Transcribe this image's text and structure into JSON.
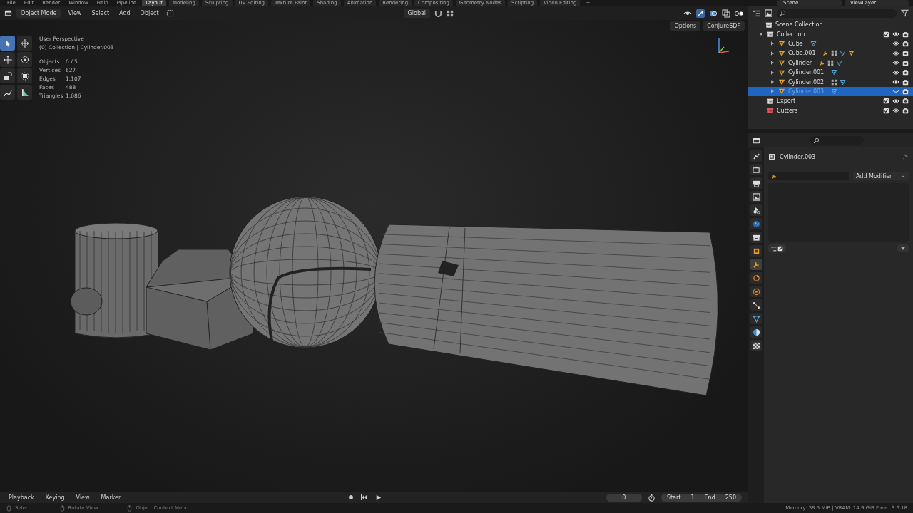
{
  "top_menu": [
    "File",
    "Edit",
    "Render",
    "Window",
    "Help",
    "Pipeline"
  ],
  "workspace_tabs": [
    {
      "label": "Layout",
      "selected": true
    },
    {
      "label": "Modeling",
      "selected": false
    },
    {
      "label": "Sculpting",
      "selected": false
    },
    {
      "label": "UV Editing",
      "selected": false
    },
    {
      "label": "Texture Paint",
      "selected": false
    },
    {
      "label": "Shading",
      "selected": false
    },
    {
      "label": "Animation",
      "selected": false
    },
    {
      "label": "Rendering",
      "selected": false
    },
    {
      "label": "Compositing",
      "selected": false
    },
    {
      "label": "Geometry Nodes",
      "selected": false
    },
    {
      "label": "Scripting",
      "selected": false
    },
    {
      "label": "Video Editing",
      "selected": false
    }
  ],
  "add_tab": "+",
  "scene": "Scene",
  "view_layer": "ViewLayer",
  "header": {
    "mode": "Object Mode",
    "menus": [
      "View",
      "Select",
      "Add",
      "Object"
    ],
    "orientation": "Global"
  },
  "viewport": {
    "buttons": [
      "Options",
      "ConjureSDF"
    ],
    "view_name": "User Perspective",
    "context": "(0) Collection | Cylinder.003",
    "stats": [
      {
        "label": "Objects",
        "value": "0 / 5"
      },
      {
        "label": "Vertices",
        "value": "627"
      },
      {
        "label": "Edges",
        "value": "1,107"
      },
      {
        "label": "Faces",
        "value": "488"
      },
      {
        "label": "Triangles",
        "value": "1,086"
      }
    ],
    "tools": [
      {
        "kind": "select",
        "selected": true
      },
      {
        "kind": "cursor",
        "selected": false
      },
      {
        "kind": "move",
        "selected": false
      },
      {
        "kind": "rotate",
        "selected": false
      },
      {
        "kind": "scale",
        "selected": false
      },
      {
        "kind": "transform",
        "selected": false
      },
      {
        "kind": "annotate",
        "selected": false
      },
      {
        "kind": "measure",
        "selected": false
      }
    ]
  },
  "outliner": {
    "root": "Scene Collection",
    "items": [
      {
        "name": "Collection",
        "kind": "collection",
        "checked": true,
        "expanded": true,
        "children": [
          {
            "name": "Cube",
            "kind": "object",
            "selected": false,
            "visible": true,
            "badges": [
              {
                "kind": "mesh"
              }
            ]
          },
          {
            "name": "Cube.001",
            "kind": "object",
            "selected": false,
            "visible": true,
            "badges": [
              {
                "kind": "wrench"
              },
              {
                "kind": "grid"
              },
              {
                "kind": "mesh"
              },
              {
                "kind": "object"
              }
            ]
          },
          {
            "name": "Cylinder",
            "kind": "object",
            "selected": false,
            "visible": true,
            "badges": [
              {
                "kind": "wrench"
              },
              {
                "kind": "grid"
              },
              {
                "kind": "mesh"
              }
            ]
          },
          {
            "name": "Cylinder.001",
            "kind": "object",
            "selected": false,
            "visible": true,
            "badges": [
              {
                "kind": "mesh"
              }
            ]
          },
          {
            "name": "Cylinder.002",
            "kind": "object",
            "selected": false,
            "visible": true,
            "badges": [
              {
                "kind": "grid"
              },
              {
                "kind": "mesh"
              }
            ]
          },
          {
            "name": "Cylinder.003",
            "kind": "object",
            "selected": true,
            "visible": false,
            "badges": [
              {
                "kind": "mesh"
              }
            ]
          }
        ]
      },
      {
        "name": "Export",
        "kind": "collection",
        "checked": true
      },
      {
        "name": "Cutters",
        "kind": "collection",
        "checked": true,
        "color": "#e05656"
      }
    ]
  },
  "properties": {
    "object_name": "Cylinder.003",
    "add_button": "Add Modifier",
    "tabs": [
      {
        "kind": "tool",
        "selected": false
      },
      {
        "kind": "render",
        "selected": false
      },
      {
        "kind": "output",
        "selected": false
      },
      {
        "kind": "view",
        "selected": false
      },
      {
        "kind": "scene",
        "selected": false
      },
      {
        "kind": "world",
        "selected": false
      },
      {
        "kind": "collection",
        "selected": false
      },
      {
        "kind": "object",
        "selected": false
      },
      {
        "kind": "wrench",
        "selected": true
      },
      {
        "kind": "particles",
        "selected": false
      },
      {
        "kind": "physics",
        "selected": false
      },
      {
        "kind": "constraints",
        "selected": false
      },
      {
        "kind": "data",
        "selected": false
      },
      {
        "kind": "material",
        "selected": false
      },
      {
        "kind": "texture",
        "selected": false
      }
    ]
  },
  "timeline": {
    "menus": [
      "Playback",
      "Keying",
      "View",
      "Marker"
    ],
    "current_frame": "0",
    "start_label": "Start",
    "start": "1",
    "end_label": "End",
    "end": "250"
  },
  "status_bar": {
    "hints": [
      "Select",
      "Rotate View",
      "Object Context Menu"
    ],
    "info": "Memory: 38.5 MiB | VRAM: 14.9 GiB Free | 3.6.18"
  }
}
